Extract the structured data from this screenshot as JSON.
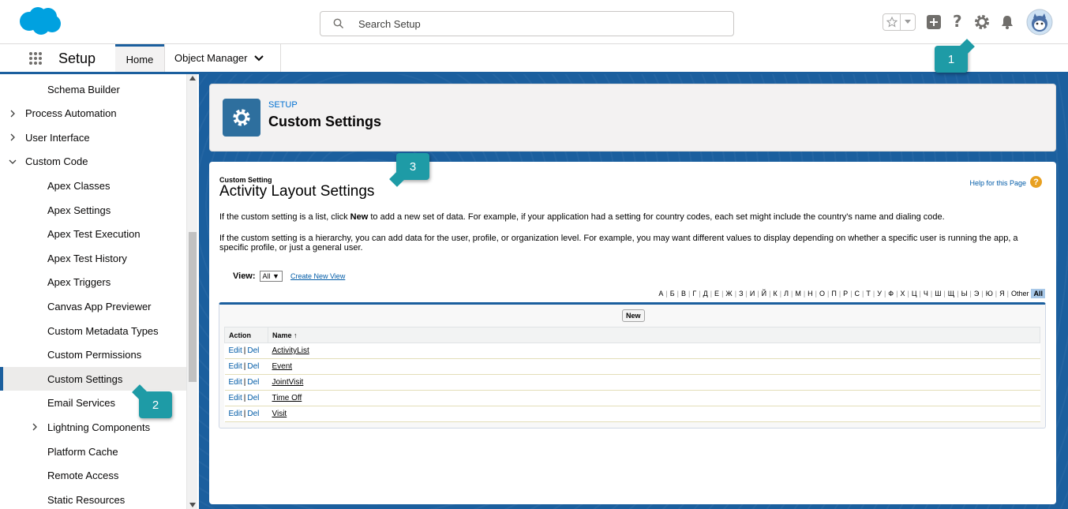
{
  "header": {
    "search_placeholder": "Search Setup"
  },
  "app_nav": {
    "app_name": "Setup",
    "tabs": [
      {
        "label": "Home"
      },
      {
        "label": "Object Manager"
      }
    ]
  },
  "callouts": [
    "1",
    "2",
    "3"
  ],
  "sidebar": {
    "items": [
      {
        "label": "Schema Builder",
        "level": 1
      },
      {
        "label": "Process Automation",
        "level": 0,
        "chevron": "right"
      },
      {
        "label": "User Interface",
        "level": 0,
        "chevron": "right"
      },
      {
        "label": "Custom Code",
        "level": 0,
        "chevron": "down"
      },
      {
        "label": "Apex Classes",
        "level": 1
      },
      {
        "label": "Apex Settings",
        "level": 1
      },
      {
        "label": "Apex Test Execution",
        "level": 1
      },
      {
        "label": "Apex Test History",
        "level": 1
      },
      {
        "label": "Apex Triggers",
        "level": 1
      },
      {
        "label": "Canvas App Previewer",
        "level": 1
      },
      {
        "label": "Custom Metadata Types",
        "level": 1
      },
      {
        "label": "Custom Permissions",
        "level": 1
      },
      {
        "label": "Custom Settings",
        "level": 1,
        "active": true
      },
      {
        "label": "Email Services",
        "level": 1
      },
      {
        "label": "Lightning Components",
        "level": 1,
        "chevron": "right"
      },
      {
        "label": "Platform Cache",
        "level": 1
      },
      {
        "label": "Remote Access",
        "level": 1
      },
      {
        "label": "Static Resources",
        "level": 1
      }
    ]
  },
  "page_header": {
    "label": "SETUP",
    "title": "Custom Settings"
  },
  "content": {
    "type_label": "Custom Setting",
    "title": "Activity Layout Settings",
    "help_link": "Help for this Page",
    "para1_pre": "If the custom setting is a list, click ",
    "para1_bold": "New",
    "para1_post": " to add a new set of data. For example, if your application had a setting for country codes, each set might include the country's name and dialing code.",
    "para2": "If the custom setting is a hierarchy, you can add data for the user, profile, or organization level. For example, you may want different values to display depending on whether a specific user is running the app, a specific profile, or just a general user.",
    "view_label": "View:",
    "view_value": "All ▼",
    "create_view": "Create New View",
    "alphabet": [
      "А",
      "Б",
      "В",
      "Г",
      "Д",
      "Е",
      "Ж",
      "З",
      "И",
      "Й",
      "К",
      "Л",
      "М",
      "Н",
      "О",
      "П",
      "Р",
      "С",
      "Т",
      "У",
      "Ф",
      "Х",
      "Ц",
      "Ч",
      "Ш",
      "Щ",
      "Ы",
      "Э",
      "Ю",
      "Я",
      "Other"
    ],
    "alphabet_all": "All",
    "new_button": "New",
    "table": {
      "col_action": "Action",
      "col_name": "Name ↑",
      "edit": "Edit",
      "del": "Del",
      "rows": [
        "ActivityList",
        "Event",
        "JointVisit",
        "Time Off",
        "Visit"
      ]
    }
  },
  "colors": {
    "brand_blue": "#1b5f9e",
    "callout_teal": "#1e9ba6",
    "link_blue": "#015ba7"
  }
}
